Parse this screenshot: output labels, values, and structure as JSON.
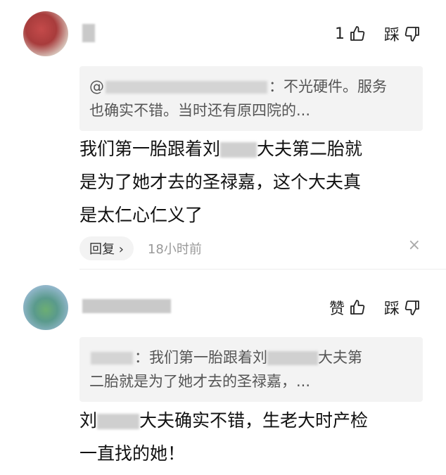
{
  "comments": [
    {
      "like_count": "1",
      "dislike_label": "踩",
      "quote_prefix": "@",
      "quote_text_1": "：不光硬件。服务",
      "quote_text_2": "也确实不错。当时还有原四院的...",
      "body_1": "我们第一胎跟着刘",
      "body_2": "大夫第二胎就",
      "body_3": "是为了她才去的圣禄嘉，这个大夫真",
      "body_4": "是太仁心仁义了",
      "reply_label": "回复 ›",
      "time": "18小时前",
      "close_label": "×"
    },
    {
      "like_label": "赞",
      "dislike_label": "踩",
      "quote_text_1": "：我们第一胎跟着刘",
      "quote_text_2": "大夫第",
      "quote_text_3": "二胎就是为了她才去的圣禄嘉，...",
      "body_1": "刘",
      "body_2": "大夫确实不错，生老大时产检",
      "body_3": "一直找的她！"
    }
  ]
}
